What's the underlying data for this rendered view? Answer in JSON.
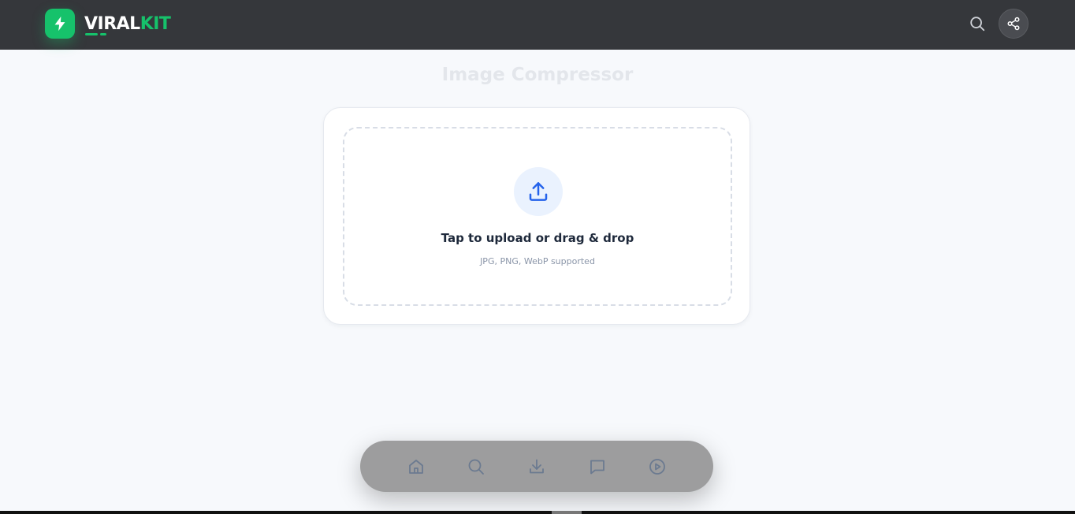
{
  "header": {
    "logo": {
      "text_primary": "VIRAL",
      "text_accent": "KIT",
      "icon": "lightning-bolt-icon",
      "accent_color": "#16c26b"
    },
    "actions": [
      {
        "name": "search",
        "icon": "search-icon"
      },
      {
        "name": "share",
        "icon": "share-icon"
      }
    ],
    "background": "#35373b"
  },
  "page": {
    "title": "Image Compressor"
  },
  "upload": {
    "icon": "upload-icon",
    "title": "Tap to upload or drag & drop",
    "subtitle": "JPG, PNG, WebP supported",
    "icon_color": "#2563eb"
  },
  "bottom_nav": {
    "items": [
      {
        "name": "home",
        "icon": "home-icon"
      },
      {
        "name": "search",
        "icon": "search-icon"
      },
      {
        "name": "download",
        "icon": "download-icon"
      },
      {
        "name": "chat",
        "icon": "chat-icon"
      },
      {
        "name": "play",
        "icon": "play-icon"
      }
    ],
    "icon_color": "#6b7a90"
  }
}
